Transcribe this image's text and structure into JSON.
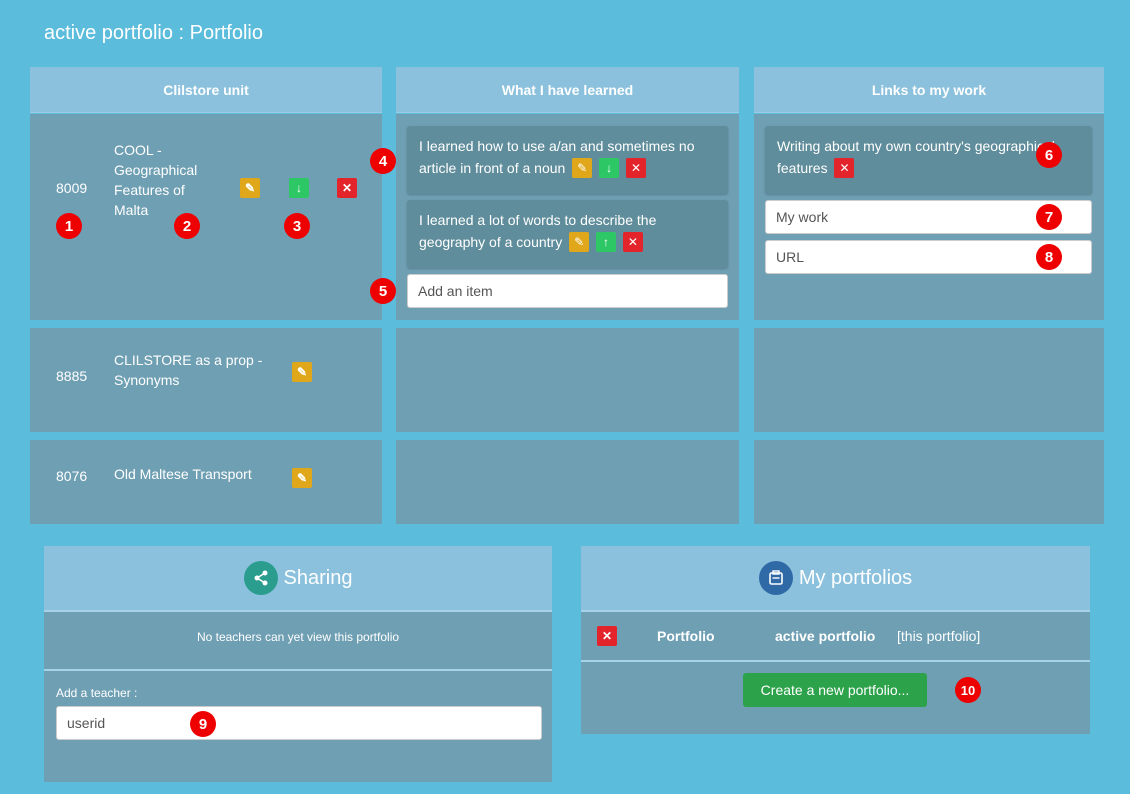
{
  "header": {
    "title": "active portfolio : Portfolio"
  },
  "columns": {
    "unit_label": "Clilstore unit",
    "learned_label": "What I have learned",
    "links_label": "Links to my work"
  },
  "units": [
    {
      "id": "8009",
      "name": "COOL - Geographical Features of Malta"
    },
    {
      "id": "8885",
      "name": "CLILSTORE as a prop - Synonyms"
    },
    {
      "id": "8076",
      "name": "Old Maltese Transport"
    }
  ],
  "learned": {
    "items": [
      "I learned how to use a/an and sometimes no article in front of a noun",
      "I learned a lot of words to describe the geography of a country"
    ],
    "add_placeholder": "Add an item"
  },
  "links": {
    "items": [
      "Writing about my own country's geographical features"
    ],
    "work_placeholder": "My work",
    "url_placeholder": "URL"
  },
  "badges": [
    "1",
    "2",
    "3",
    "4",
    "5",
    "6",
    "7",
    "8",
    "9",
    "10"
  ],
  "sharing": {
    "title": "Sharing",
    "status": "No teachers can yet view this portfolio",
    "add_label": "Add a teacher :",
    "userid_placeholder": "userid"
  },
  "portfolios": {
    "title": "My portfolios",
    "row_name": "Portfolio",
    "row_active": "active portfolio",
    "row_note": "[this portfolio]",
    "create_label": "Create a new portfolio..."
  },
  "colors": {
    "background": "#5bbcdc",
    "header": "#8bc1dd",
    "cell": "#6f9fb3",
    "edit": "#e0a71b",
    "move": "#2dc766",
    "delete": "#e3242b",
    "create": "#2ca24a",
    "badge": "#ee0000"
  },
  "icons": {
    "edit": "pencil-icon",
    "down": "arrow-down-icon",
    "up": "arrow-up-icon",
    "delete": "trash-icon",
    "share": "share-icon",
    "portfolio": "portfolio-icon"
  }
}
